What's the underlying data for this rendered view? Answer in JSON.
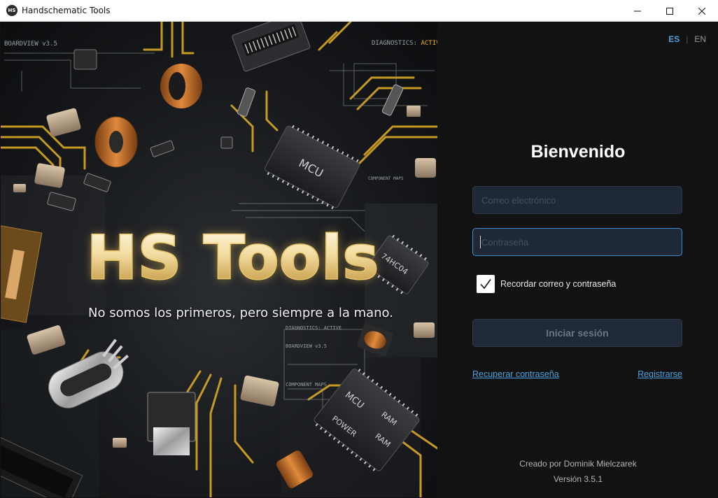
{
  "window": {
    "title": "Handschematic Tools",
    "icon_text": "HS",
    "controls": {
      "minimize": "minimize-icon",
      "maximize": "maximize-icon",
      "close": "close-icon"
    }
  },
  "hero": {
    "title": "HS Tools",
    "tagline": "No somos los primeros, pero siempre a la mano.",
    "overlay_labels": {
      "boardview_top": "BOARDVIEW v3.5",
      "diagnostics_top_prefix": "DIAGNOSTICS: ",
      "diagnostics_top_status": "ACTIVE",
      "component_maps_top": "COMPONENT MAPS",
      "diagnostics_mid": "DIAGNOSTICS: ACTIVE",
      "boardview_mid": "BOARDVIEW v3.5",
      "component_maps_mid": "COMPONENT MAPS"
    },
    "chip_labels": {
      "mcu_top": "MCU",
      "chip_74": "74HC04",
      "mcu_bottom": "MCU",
      "ram_1": "RAM",
      "ram_2": "RAM",
      "power": "POWER"
    }
  },
  "login": {
    "languages": {
      "es": "ES",
      "separator": "|",
      "en": "EN"
    },
    "welcome": "Bienvenido",
    "email_placeholder": "Correo electrónico",
    "password_placeholder": "Contraseña",
    "remember_label": "Recordar correo y contraseña",
    "remember_checked": true,
    "submit_label": "Iniciar sesión",
    "recover_link": "Recuperar contraseña",
    "register_link": "Registrarse",
    "credits": "Creado por Dominik Mielczarek",
    "version": "Versión 3.5.1"
  },
  "colors": {
    "accent_link": "#4fa3e0",
    "gold": "#e9c56a",
    "panel_bg": "#121212",
    "field_bg": "#1e2836",
    "focus_border": "#3d8fd6"
  }
}
